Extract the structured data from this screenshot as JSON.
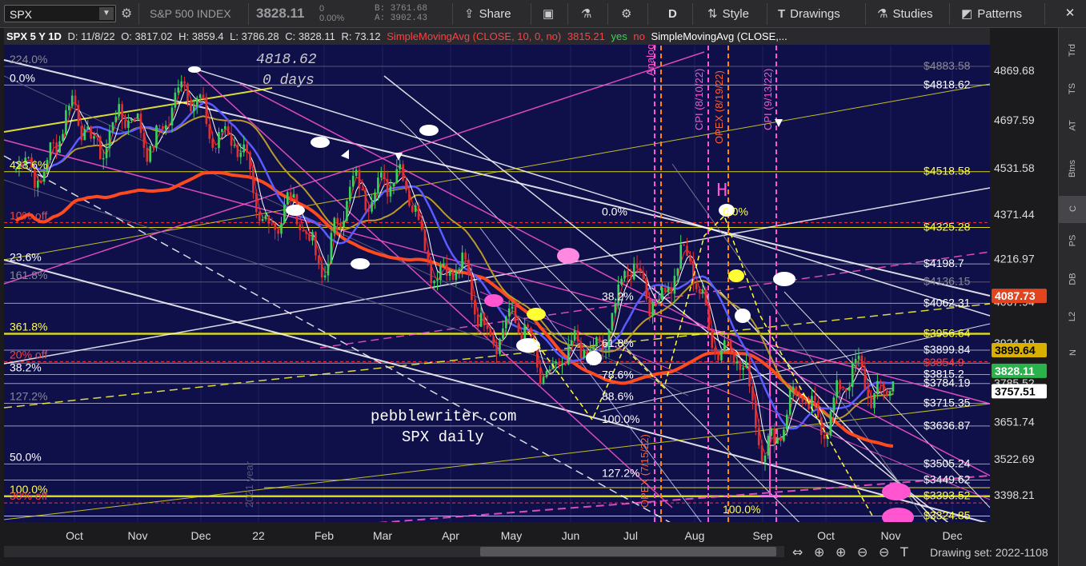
{
  "toolbar": {
    "symbol": "SPX",
    "index_name": "S&P 500 INDEX",
    "last": "3828.11",
    "change_line1": "0",
    "change_line2": "0.00%",
    "bid": "B: 3761.68",
    "ask": "A: 3902.43",
    "share": "Share",
    "period": "D",
    "style": "Style",
    "drawings": "Drawings",
    "studies": "Studies",
    "patterns": "Patterns"
  },
  "header": {
    "symbol_period": "SPX 5 Y 1D",
    "date": "D: 11/8/22",
    "open": "O: 3817.02",
    "high": "H: 3859.4",
    "low": "L: 3786.28",
    "close": "C: 3828.11",
    "range": "R: 73.12",
    "study1": "SimpleMovingAvg (CLOSE, 10, 0, no)",
    "study1_val": "3815.21",
    "yes": "yes",
    "no": "no",
    "study2": "SimpleMovingAvg (CLOSE,..."
  },
  "right_rail": [
    "Trd",
    "TS",
    "AT",
    "Btns",
    "C",
    "PS",
    "DB",
    "L2",
    "N"
  ],
  "price_axis": [
    {
      "label": "4869.68",
      "price": 4869.68
    },
    {
      "label": "4697.59",
      "price": 4697.59
    },
    {
      "label": "4531.58",
      "price": 4531.58
    },
    {
      "label": "4371.44",
      "price": 4371.44
    },
    {
      "label": "4216.97",
      "price": 4216.97
    },
    {
      "label": "4067.94",
      "price": 4067.94
    },
    {
      "label": "3924.19",
      "price": 3924.19
    },
    {
      "label": "3785.52",
      "price": 3785.52
    },
    {
      "label": "3651.74",
      "price": 3651.74
    },
    {
      "label": "3522.69",
      "price": 3522.69
    },
    {
      "label": "3398.21",
      "price": 3398.21
    }
  ],
  "price_flags": [
    {
      "label": "4087.73",
      "price": 4087.73,
      "color": "#e0451f",
      "text": "#ffffff"
    },
    {
      "label": "3899.64",
      "price": 3899.64,
      "color": "#d9b000",
      "text": "#000000"
    },
    {
      "label": "3828.11",
      "price": 3828.11,
      "color": "#29b34a",
      "text": "#ffffff"
    },
    {
      "label": "3757.51",
      "price": 3757.51,
      "color": "#ffffff",
      "text": "#000000"
    }
  ],
  "level_labels": [
    {
      "label": "$4883.58",
      "price": 4883.58,
      "color": "#8a8a96"
    },
    {
      "label": "$4818.62",
      "price": 4818.62,
      "color": "#ffffff"
    },
    {
      "label": "$4518.58",
      "price": 4518.58,
      "color": "#ffff4d"
    },
    {
      "label": "$4325.28",
      "price": 4325.28,
      "color": "#ffff4d"
    },
    {
      "label": "$4198.7",
      "price": 4198.7,
      "color": "#ffffff"
    },
    {
      "label": "$4136.15",
      "price": 4136.15,
      "color": "#8a8a96"
    },
    {
      "label": "$4062.31",
      "price": 4062.31,
      "color": "#ffffff"
    },
    {
      "label": "$3956.64",
      "price": 3956.64,
      "color": "#ffff4d"
    },
    {
      "label": "$3899.84",
      "price": 3899.84,
      "color": "#ffffff"
    },
    {
      "label": "$3854.9",
      "price": 3854.9,
      "color": "#ff4040"
    },
    {
      "label": "$3815.2",
      "price": 3815.2,
      "color": "#ffffff"
    },
    {
      "label": "$3784.19",
      "price": 3784.19,
      "color": "#ffffff"
    },
    {
      "label": "$3715.35",
      "price": 3715.35,
      "color": "#ffffff"
    },
    {
      "label": "$3636.87",
      "price": 3636.87,
      "color": "#ffffff"
    },
    {
      "label": "$3505.24",
      "price": 3505.24,
      "color": "#ffffff"
    },
    {
      "label": "$3449.62",
      "price": 3449.62,
      "color": "#ffffff"
    },
    {
      "label": "$3393.52",
      "price": 3393.52,
      "color": "#ffff4d"
    },
    {
      "label": "$3324.85",
      "price": 3324.85,
      "color": "#ffff4d"
    }
  ],
  "fib_labels": [
    {
      "label": "224.0%",
      "x": 12,
      "price": 4883,
      "color": "#8a8a96"
    },
    {
      "label": "0.0%",
      "x": 12,
      "price": 4818,
      "color": "#ffffff"
    },
    {
      "label": "423.6%",
      "x": 12,
      "price": 4518,
      "color": "#ffff4d"
    },
    {
      "label": "10% off",
      "x": 12,
      "price": 4342,
      "color": "#ff4040"
    },
    {
      "label": "23.6%",
      "x": 12,
      "price": 4198,
      "color": "#ffffff"
    },
    {
      "label": "161.8%",
      "x": 12,
      "price": 4136,
      "color": "#8a8a96"
    },
    {
      "label": "361.8%",
      "x": 12,
      "price": 3956,
      "color": "#ffff4d"
    },
    {
      "label": "20% off",
      "x": 12,
      "price": 3860,
      "color": "#ff4040"
    },
    {
      "label": "38.2%",
      "x": 12,
      "price": 3815,
      "color": "#ffffff"
    },
    {
      "label": "127.2%",
      "x": 12,
      "price": 3715,
      "color": "#8a8a96"
    },
    {
      "label": "50.0%",
      "x": 12,
      "price": 3505,
      "color": "#ffffff"
    },
    {
      "label": "100.0%",
      "x": 12,
      "price": 3393,
      "color": "#ffff4d"
    },
    {
      "label": "30% off",
      "x": 12,
      "price": 3370,
      "color": "#ff4040"
    },
    {
      "label": "0.0%",
      "x": 752,
      "price": 4355,
      "color": "#ffffff"
    },
    {
      "label": "38.2%",
      "x": 752,
      "price": 4062,
      "color": "#ffffff"
    },
    {
      "label": "61.8%",
      "x": 752,
      "price": 3900,
      "color": "#ffffff"
    },
    {
      "label": "78.6%",
      "x": 752,
      "price": 3790,
      "color": "#ffffff"
    },
    {
      "label": "88.6%",
      "x": 752,
      "price": 3715,
      "color": "#ffffff"
    },
    {
      "label": "100.0%",
      "x": 752,
      "price": 3636,
      "color": "#ffffff"
    },
    {
      "label": "127.2%",
      "x": 752,
      "price": 3449,
      "color": "#ffffff"
    },
    {
      "label": "0.0%",
      "x": 903,
      "price": 4355,
      "color": "#ffff4d"
    },
    {
      "label": "100.0%",
      "x": 903,
      "price": 3324,
      "color": "#ffff4d"
    }
  ],
  "x_axis": [
    "Oct",
    "Nov",
    "Dec",
    "22",
    "Feb",
    "Mar",
    "Apr",
    "May",
    "Jun",
    "Jul",
    "Aug",
    "Sep",
    "Oct",
    "Nov",
    "Dec"
  ],
  "annotations": {
    "peak_value": "4818.62",
    "peak_days": "0 days",
    "watermark1": "pebblewriter.com",
    "watermark2": "SPX daily",
    "year_tag": "2021 year",
    "h_mark": "H",
    "event_analog": "Analog",
    "event_cpi1": "CPI (8/10/22)",
    "event_opex": "OPEX (8/19/22)",
    "event_cpi2": "CPI (9/13/22)",
    "event_opex2": "OPEX (7/15/22)"
  },
  "drawing_set": "Drawing set: 2022-1108",
  "colors": {
    "bg": "#0f0f4a",
    "up": "#3ad35a",
    "down": "#e03030",
    "sma200": "#ff4a1f",
    "sma50": "#5a5cff",
    "sma100": "#b99a2a",
    "yellow": "#ffff33",
    "magenta": "#ff55d0"
  },
  "chart_data": {
    "type": "candlestick",
    "title": "SPX 5 Y 1D",
    "x": [
      "Oct 21",
      "Nov 21",
      "Dec 21",
      "Jan 22",
      "Feb 22",
      "Mar 22",
      "Apr 22",
      "May 22",
      "Jun 22",
      "Jul 22",
      "Aug 22",
      "Sep 22",
      "Oct 22",
      "Nov 22"
    ],
    "series": [
      {
        "values": [
          4500,
          4680,
          4650,
          4780,
          4420,
          4250,
          4550,
          4150,
          3950,
          3820,
          4130,
          4150,
          3620,
          3830
        ]
      }
    ],
    "last_close": 3828.11,
    "ylim": [
      3320,
      4900
    ]
  }
}
